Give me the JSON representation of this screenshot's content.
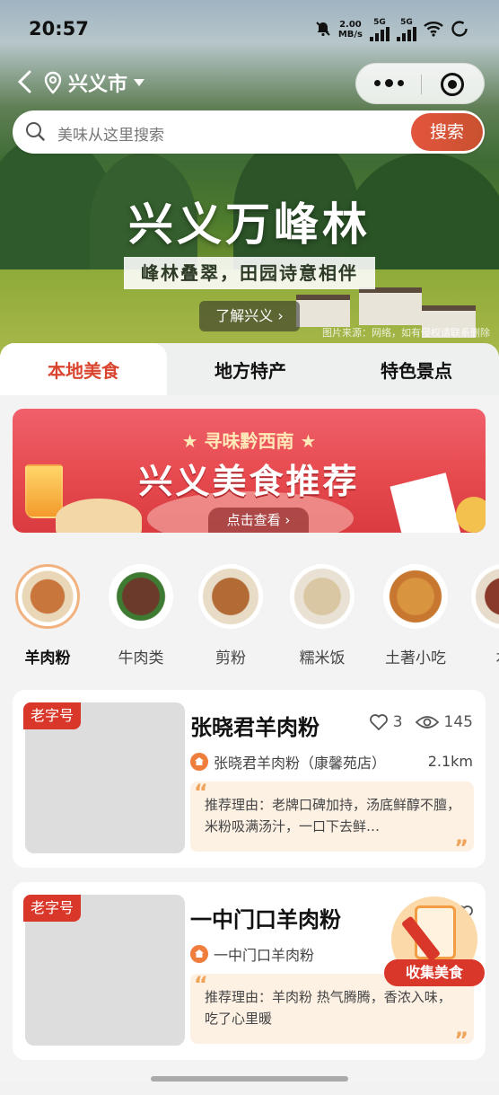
{
  "status_bar": {
    "time": "20:57",
    "net_speed": "2.00",
    "net_unit": "MB/s",
    "sig1": "5G",
    "sig2": "5G"
  },
  "nav": {
    "city": "兴义市"
  },
  "search": {
    "placeholder": "美味从这里搜索",
    "button": "搜索"
  },
  "hero": {
    "title": "兴义万峰林",
    "subtitle": "峰林叠翠，田园诗意相伴",
    "more": "了解兴义 ›",
    "note": "图片来源：网络，如有侵权请联系删除"
  },
  "tabs": [
    {
      "label": "本地美食",
      "active": true
    },
    {
      "label": "地方特产",
      "active": false
    },
    {
      "label": "特色景点",
      "active": false
    }
  ],
  "banner": {
    "kicker": "★ 寻味黔西南 ★",
    "headline": "兴义美食推荐",
    "cta": "点击查看 ›"
  },
  "categories": [
    {
      "label": "羊肉粉",
      "active": true,
      "color": "#c9763c"
    },
    {
      "label": "牛肉类",
      "active": false,
      "color": "#6b3a2a"
    },
    {
      "label": "剪粉",
      "active": false,
      "color": "#b36b35"
    },
    {
      "label": "糯米饭",
      "active": false,
      "color": "#d8c7a2"
    },
    {
      "label": "土著小吃",
      "active": false,
      "color": "#d99440"
    },
    {
      "label": "本",
      "active": false,
      "color": "#8a3a2a"
    }
  ],
  "cards": [
    {
      "badge": "老字号",
      "name": "张晓君羊肉粉",
      "likes": "3",
      "views": "145",
      "shop": "张晓君羊肉粉（康馨苑店）",
      "distance": "2.1km",
      "reason": "推荐理由：老牌口碑加持，汤底鲜醇不膻，米粉吸满汤汁，一口下去鲜…"
    },
    {
      "badge": "老字号",
      "name": "一中门口羊肉粉",
      "likes": "",
      "views": "",
      "shop": "一中门口羊肉粉",
      "distance": "",
      "reason": "推荐理由：羊肉粉 热气腾腾，香浓入味，吃了心里暖"
    }
  ],
  "float_button": {
    "label": "收集美食"
  },
  "colors": {
    "accent": "#d9452e",
    "badge": "#d9372a",
    "reason_bg": "#fdf1e4"
  }
}
